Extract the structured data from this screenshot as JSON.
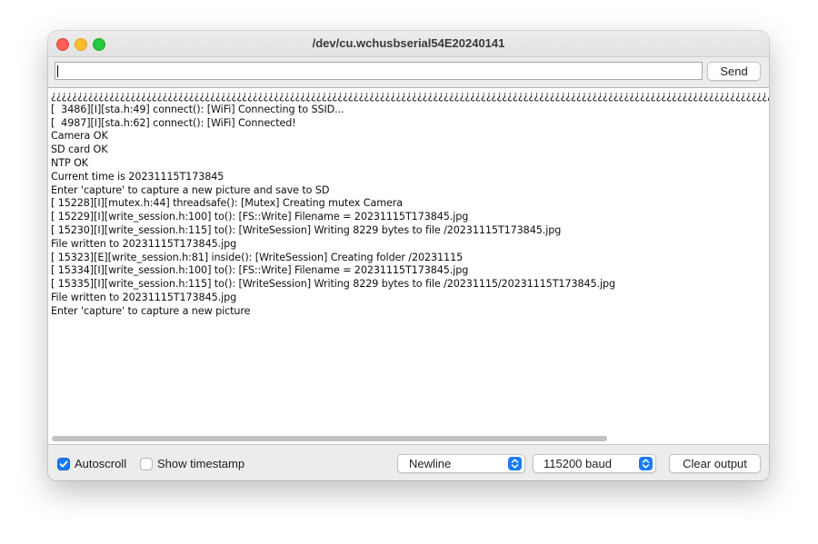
{
  "window": {
    "title": "/dev/cu.wchusbserial54E20240141"
  },
  "input": {
    "value": "",
    "send_label": "Send"
  },
  "output": {
    "lines": [
      "\u0000\u0000\u0000\u0000\u0000\u0000\u0000\u0000\u0000\u0000\u0000\u0000\u0000\u0000\u0000\u0000\u0000\u0000\u0000\u0000\u0000\u0000\u0000\u0000\u0000\u0000\u0000\u0000\u0000\u0000\u0000\u0000\u0000\u0000\u0000\u0000\u0000\u0000\u0000\u0000\u0000\u0000\u0000\u0000\u0000\u0000\u0000\u0000\u0000\u0000\u0000\u0000\u0000\u0000\u0000\u0000\u0000\u0000\u0000\u0000\u0000\u0000\u0000\u0000\u0000\u0000\u0000\u0000\u0000\u0000\u0000\u0000\u0000\u0000\u0000\u0000\u0000\u0000\u0000\u0000\u0000\u0000\u0000\u0000\u0000\u0000\u0000\u0000\u0000\u0000\u0000\u0000\u0000\u0000\u0000\u0000\u0000\u0000\u0000\u0000\u0000\u0000\u0000\u0000\u0000\u0000\u0000\u0000\u0000\u0000\u0000\u0000\u0000\u0000\u0000\u0000\u0000\u0000\u0000\u0000\u0000\u0000\u0000\u0000\u0000\u0000\u0000\u0000\u0000\u0000\u0000\u0000\u0000\u0000\u0000\u0000",
      "[  3486][I][sta.h:49] connect(): [WiFi] Connecting to SSID...",
      "[  4987][I][sta.h:62] connect(): [WiFi] Connected!",
      "Camera OK",
      "SD card OK",
      "NTP OK",
      "Current time is 20231115T173845",
      "Enter 'capture' to capture a new picture and save to SD",
      "[ 15228][I][mutex.h:44] threadsafe(): [Mutex] Creating mutex Camera",
      "[ 15229][I][write_session.h:100] to(): [FS::Write] Filename = 20231115T173845.jpg",
      "[ 15230][I][write_session.h:115] to(): [WriteSession] Writing 8229 bytes to file /20231115T173845.jpg",
      "File written to 20231115T173845.jpg",
      "[ 15323][E][write_session.h:81] inside(): [WriteSession] Creating folder /20231115",
      "[ 15334][I][write_session.h:100] to(): [FS::Write] Filename = 20231115T173845.jpg",
      "[ 15335][I][write_session.h:115] to(): [WriteSession] Writing 8229 bytes to file /20231115/20231115T173845.jpg",
      "File written to 20231115T173845.jpg",
      "Enter 'capture' to capture a new picture"
    ]
  },
  "footer": {
    "autoscroll": {
      "label": "Autoscroll",
      "checked": true
    },
    "show_timestamp": {
      "label": "Show timestamp",
      "checked": false
    },
    "line_ending": "Newline",
    "baud_rate": "115200 baud",
    "clear_label": "Clear output"
  },
  "colors": {
    "accent": "#1a7cf2",
    "close": "#ff5f57",
    "minimize": "#febc2e",
    "zoom": "#28c840"
  }
}
